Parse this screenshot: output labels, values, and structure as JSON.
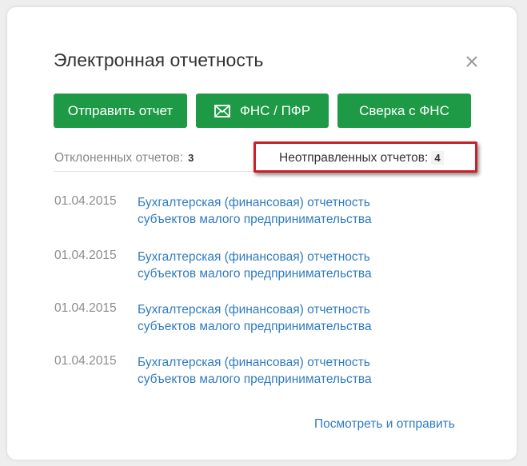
{
  "panel": {
    "title": "Электронная отчетность",
    "close_icon": "close-icon"
  },
  "buttons": {
    "send_report": "Отправить отчет",
    "fns_pfr": "ФНС / ПФР",
    "fns_pfr_icon": "envelope-icon",
    "sverka": "Сверка с ФНС"
  },
  "stats": {
    "rejected_label": "Отклоненных отчетов:",
    "rejected_count": "3",
    "unsent_label": "Неотправленных отчетов:",
    "unsent_count": "4"
  },
  "reports": [
    {
      "date": "01.04.2015",
      "line1": "Бухгалтерская (финансовая) отчетность",
      "line2": "субъектов малого предпринимательства"
    },
    {
      "date": "01.04.2015",
      "line1": "Бухгалтерская (финансовая) отчетность",
      "line2": "субъектов малого предпринимательства"
    },
    {
      "date": "01.04.2015",
      "line1": "Бухгалтерская (финансовая) отчетность",
      "line2": "субъектов малого предпринимательства"
    },
    {
      "date": "01.04.2015",
      "line1": "Бухгалтерская (финансовая) отчетность",
      "line2": "субъектов малого предпринимательства"
    }
  ],
  "footer": {
    "view_and_send": "Посмотреть и отправить"
  },
  "colors": {
    "button_green": "#1e9a46",
    "link_blue": "#2f7bbf",
    "highlight_red": "#cc1f27"
  }
}
